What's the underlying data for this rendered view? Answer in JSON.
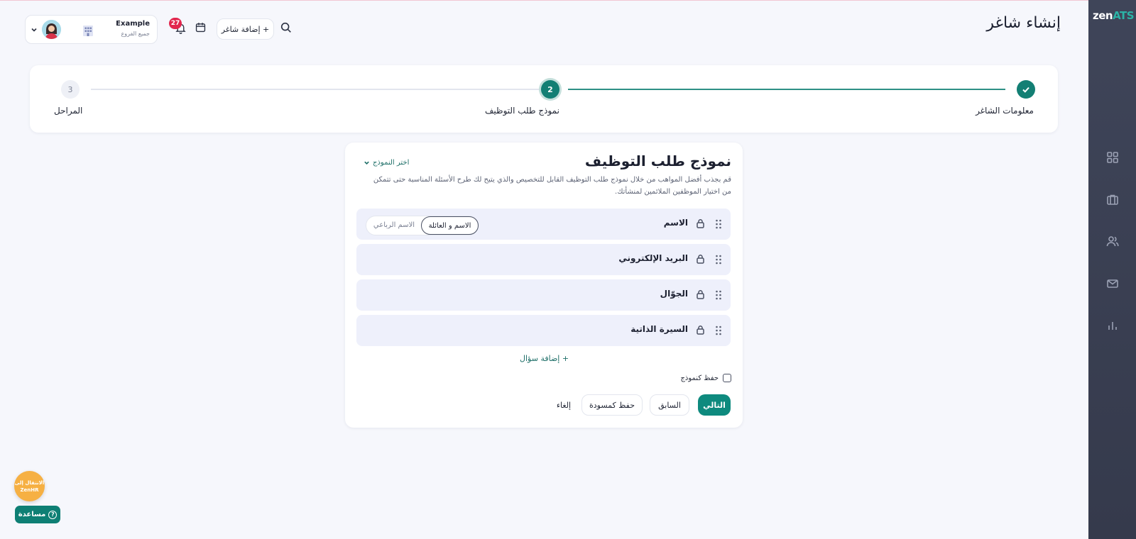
{
  "header": {
    "page_title": "إنشاء شاغر",
    "add_candidate_label": "+ إضافة شاغر",
    "notifications_count": "27",
    "company_name": "Example",
    "company_sub": "جميع الفروع"
  },
  "sidebar": {
    "logo_zen": "zen",
    "logo_ats": "ATS",
    "items": [
      "dashboard-icon",
      "briefcase-icon",
      "users-icon",
      "mail-icon",
      "chart-icon"
    ]
  },
  "stepper": {
    "steps": [
      {
        "label": "معلومات الشاغر",
        "state": "done"
      },
      {
        "label": "نموذج طلب التوظيف",
        "number": "2",
        "state": "current"
      },
      {
        "label": "المراحل",
        "number": "3",
        "state": "pending"
      }
    ]
  },
  "form": {
    "title": "نموذج طلب التوظيف",
    "choose_template": "اختر النموذج",
    "description": "قم بجذب أفضل المواهب من خلال نموذج طلب التوظيف القابل للتخصيص والذي يتيح لك طرح الأسئلة المناسبة حتى تتمكن من اختيار الموظفين الملائمين لمنشأتك.",
    "questions": [
      {
        "label": "الاسم"
      },
      {
        "label": "البريد الإلكتروني"
      },
      {
        "label": "الجوّال"
      },
      {
        "label": "السيرة الذاتية"
      }
    ],
    "name_options": {
      "active": "الاسم و العائلة",
      "inactive": "الاسم الرباعي"
    },
    "add_question": "+ إضافة سؤال",
    "save_as_template": "حفظ كنموذج",
    "buttons": {
      "next": "التالي",
      "previous": "السابق",
      "save_draft": "حفظ كمسودة",
      "cancel": "إلغاء"
    }
  },
  "floating": {
    "zenhr_line1": "الانتقال إلى",
    "zenhr_line2": "ZenHR",
    "help": "مساعدة"
  },
  "colors": {
    "accent": "#0e8a7e",
    "sidebar": "#3f4559",
    "badge": "#e2264d",
    "zenhr": "#f6b043"
  }
}
